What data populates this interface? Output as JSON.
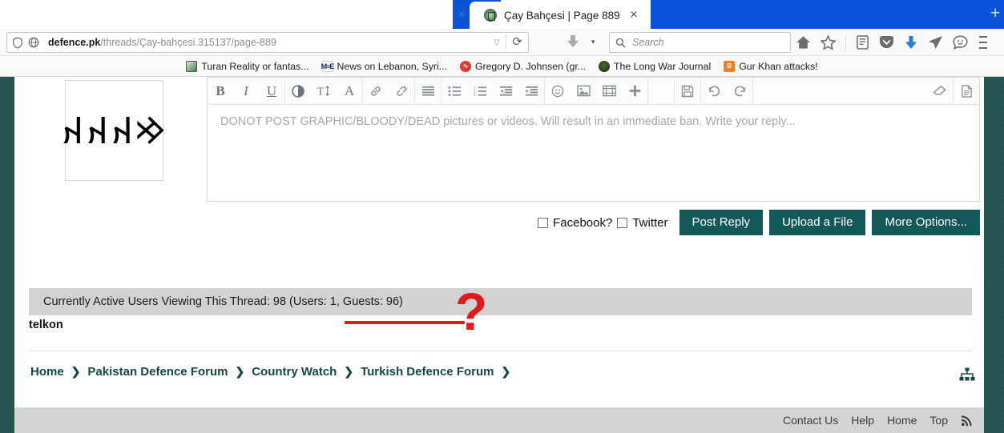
{
  "browser": {
    "tab": {
      "title": "Çay Bahçesi | Page 889",
      "favicon": "defence-pk-shield-icon",
      "close_label": "×"
    },
    "newtab_label": "+",
    "url": {
      "domain": "defence.pk",
      "path": "/threads/Çay-bahçesi.315137/page-889",
      "dropdown": "▽",
      "reload": "⟳"
    },
    "search": {
      "placeholder": "Search"
    },
    "toolbar_icons": [
      "home-icon",
      "bookmark-star-icon",
      "library-icon",
      "pocket-icon",
      "downloads-icon",
      "send-tab-icon",
      "smiley-feedback-icon",
      "menu-icon"
    ],
    "bookmarks": [
      {
        "label": "Turan Reality or fantas...",
        "favicon": "turan-icon"
      },
      {
        "label": "News on Lebanon, Syri...",
        "favicon": "middle-east-eye-icon"
      },
      {
        "label": "Gregory D. Johnsen (gr...",
        "favicon": "red-circle-icon"
      },
      {
        "label": "The Long War Journal",
        "favicon": "long-war-journal-icon"
      },
      {
        "label": "Gur Khan attacks!",
        "favicon": "blogger-icon"
      }
    ]
  },
  "page": {
    "avatar": {
      "glyphs": "𐰢𐰴𐰴𐰴",
      "alt": "orkhon-runic-avatar"
    },
    "editor": {
      "placeholder": "DONOT POST GRAPHIC/BLOODY/DEAD pictures or videos. Will result in an immediate ban. Write your reply...",
      "toolbar": [
        {
          "name": "bold-icon",
          "glyph": "B",
          "style": "bold"
        },
        {
          "name": "italic-icon",
          "glyph": "I",
          "style": "ital"
        },
        {
          "name": "underline-icon",
          "glyph": "U",
          "style": "under"
        },
        {
          "name": "text-color-icon",
          "glyph": "◐",
          "style": ""
        },
        {
          "name": "font-size-icon",
          "glyph": "T↕",
          "style": "serifA"
        },
        {
          "name": "font-family-icon",
          "glyph": "A",
          "style": "serifA"
        },
        {
          "name": "insert-link-icon",
          "glyph": "🔗",
          "style": ""
        },
        {
          "name": "unlink-icon",
          "glyph": "⚯",
          "style": ""
        },
        {
          "name": "align-icon",
          "glyph": "≡",
          "style": ""
        },
        {
          "name": "bullet-list-icon",
          "glyph": "⁞≡",
          "style": ""
        },
        {
          "name": "numbered-list-icon",
          "glyph": "⒈≡",
          "style": ""
        },
        {
          "name": "outdent-icon",
          "glyph": "⇤",
          "style": ""
        },
        {
          "name": "indent-icon",
          "glyph": "⇥",
          "style": ""
        },
        {
          "name": "smiley-icon",
          "glyph": "☺",
          "style": ""
        },
        {
          "name": "insert-image-icon",
          "glyph": "🖼",
          "style": ""
        },
        {
          "name": "insert-video-icon",
          "glyph": "🎞",
          "style": ""
        },
        {
          "name": "more-media-icon",
          "glyph": "✚",
          "style": ""
        },
        {
          "name": "save-draft-icon",
          "glyph": "💾",
          "style": ""
        },
        {
          "name": "undo-icon",
          "glyph": "↺",
          "style": ""
        },
        {
          "name": "redo-icon",
          "glyph": "↻",
          "style": ""
        },
        {
          "name": "eraser-icon",
          "glyph": "🧹",
          "style": ""
        },
        {
          "name": "draft-icon",
          "glyph": "📄",
          "style": ""
        }
      ]
    },
    "actions": {
      "facebook_label": "Facebook?",
      "twitter_label": "Twitter",
      "post_reply": "Post Reply",
      "upload_file": "Upload a File",
      "more_options": "More Options..."
    },
    "active_users": {
      "summary": "Currently Active Users Viewing This Thread: 98 (Users: 1, Guests: 96)",
      "total": 98,
      "users": 1,
      "guests": 96,
      "user_list": "telkon"
    },
    "annotation": {
      "question_mark": "?"
    },
    "breadcrumb": [
      "Home",
      "Pakistan Defence Forum",
      "Country Watch",
      "Turkish Defence Forum"
    ],
    "breadcrumb_chevron": "❯",
    "sitemap_icon": "sitemap-icon",
    "footer_links": [
      "Contact Us",
      "Help",
      "Home",
      "Top"
    ],
    "footer_rss": "rss-icon"
  },
  "colors": {
    "teal_bg": "#21544f",
    "teal_button": "#14595a",
    "annotation_red": "#e01b1b",
    "tab_blue": "#0a53d8",
    "gray_bar": "#d2d2d2"
  }
}
